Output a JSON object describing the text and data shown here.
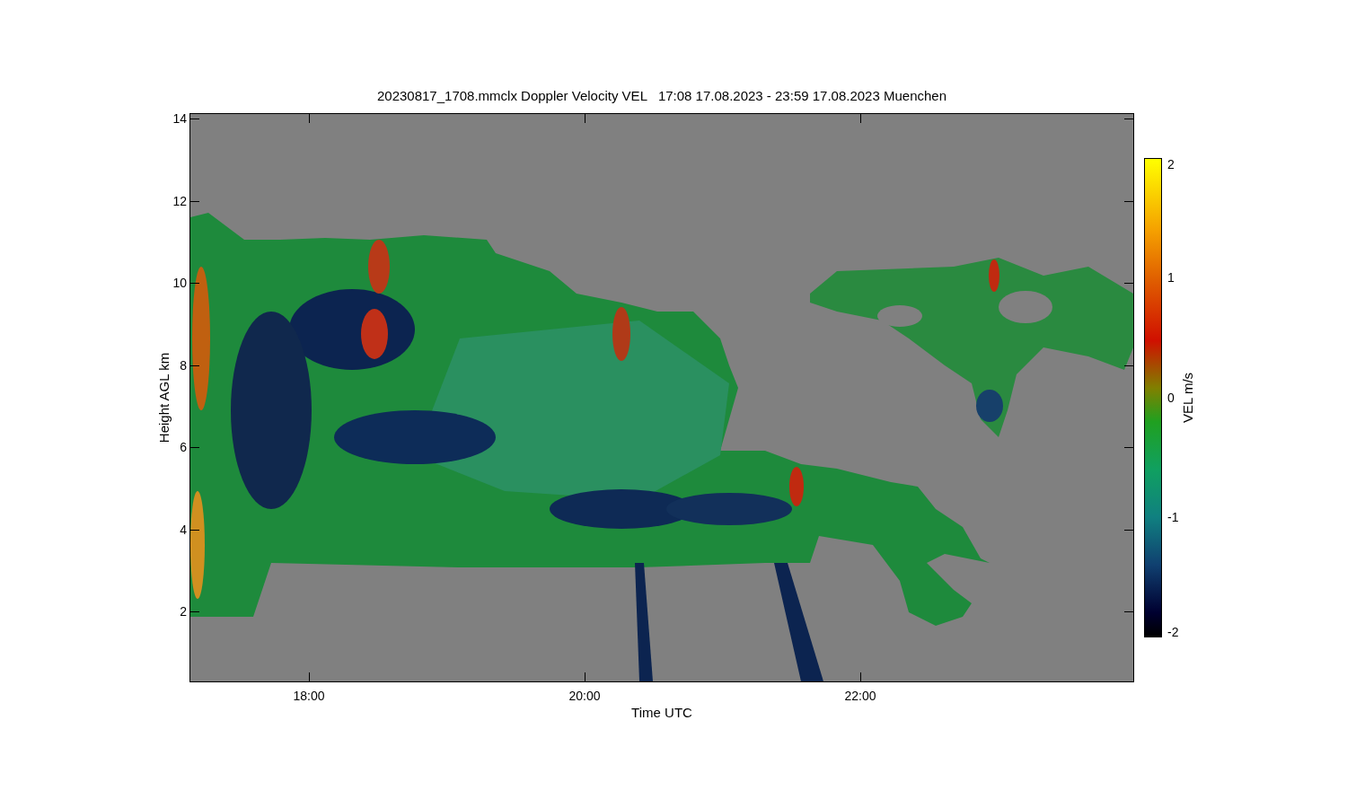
{
  "title": "20230817_1708.mmclx Doppler Velocity VEL   17:08 17.08.2023 - 23:59 17.08.2023 Muenchen",
  "y_axis": {
    "label": "Height AGL km",
    "ticks": [
      "14",
      "12",
      "10",
      "8",
      "6",
      "4",
      "2"
    ]
  },
  "x_axis": {
    "label": "Time UTC",
    "ticks": [
      "18:00",
      "20:00",
      "22:00"
    ]
  },
  "colorbar": {
    "label": "VEL m/s",
    "ticks": [
      "2",
      "1",
      "0",
      "-1",
      "-2"
    ]
  }
}
